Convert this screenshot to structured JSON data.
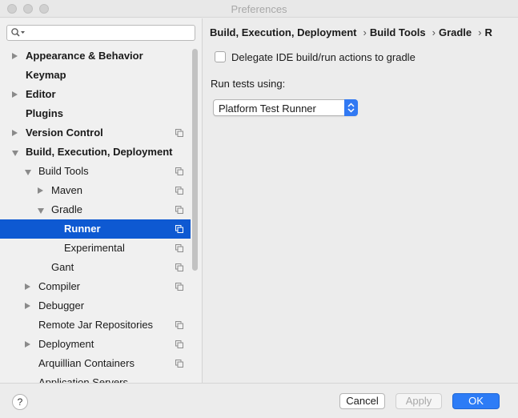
{
  "window": {
    "title": "Preferences"
  },
  "search": {
    "placeholder": ""
  },
  "tree": [
    {
      "label": "Appearance & Behavior",
      "depth": 0,
      "arrow": "right",
      "bold": true,
      "copy": false,
      "selected": false
    },
    {
      "label": "Keymap",
      "depth": 0,
      "arrow": "none",
      "bold": true,
      "copy": false,
      "selected": false
    },
    {
      "label": "Editor",
      "depth": 0,
      "arrow": "right",
      "bold": true,
      "copy": false,
      "selected": false
    },
    {
      "label": "Plugins",
      "depth": 0,
      "arrow": "none",
      "bold": true,
      "copy": false,
      "selected": false
    },
    {
      "label": "Version Control",
      "depth": 0,
      "arrow": "right",
      "bold": true,
      "copy": true,
      "selected": false
    },
    {
      "label": "Build, Execution, Deployment",
      "depth": 0,
      "arrow": "down",
      "bold": true,
      "copy": false,
      "selected": false
    },
    {
      "label": "Build Tools",
      "depth": 1,
      "arrow": "down",
      "bold": false,
      "copy": true,
      "selected": false
    },
    {
      "label": "Maven",
      "depth": 2,
      "arrow": "right",
      "bold": false,
      "copy": true,
      "selected": false
    },
    {
      "label": "Gradle",
      "depth": 2,
      "arrow": "down",
      "bold": false,
      "copy": true,
      "selected": false
    },
    {
      "label": "Runner",
      "depth": 3,
      "arrow": "none",
      "bold": true,
      "copy": true,
      "selected": true
    },
    {
      "label": "Experimental",
      "depth": 3,
      "arrow": "none",
      "bold": false,
      "copy": true,
      "selected": false
    },
    {
      "label": "Gant",
      "depth": 2,
      "arrow": "none",
      "bold": false,
      "copy": true,
      "selected": false
    },
    {
      "label": "Compiler",
      "depth": 1,
      "arrow": "right",
      "bold": false,
      "copy": true,
      "selected": false
    },
    {
      "label": "Debugger",
      "depth": 1,
      "arrow": "right",
      "bold": false,
      "copy": false,
      "selected": false
    },
    {
      "label": "Remote Jar Repositories",
      "depth": 1,
      "arrow": "none",
      "bold": false,
      "copy": true,
      "selected": false
    },
    {
      "label": "Deployment",
      "depth": 1,
      "arrow": "right",
      "bold": false,
      "copy": true,
      "selected": false
    },
    {
      "label": "Arquillian Containers",
      "depth": 1,
      "arrow": "none",
      "bold": false,
      "copy": true,
      "selected": false
    },
    {
      "label": "Application Servers",
      "depth": 1,
      "arrow": "none",
      "bold": false,
      "copy": false,
      "selected": false
    }
  ],
  "breadcrumb": [
    "Build, Execution, Deployment",
    "Build Tools",
    "Gradle",
    "R"
  ],
  "settings": {
    "delegate_label": "Delegate IDE build/run actions to gradle",
    "delegate_checked": false,
    "run_tests_label": "Run tests using:",
    "run_tests_value": "Platform Test Runner"
  },
  "footer": {
    "help_label": "?",
    "cancel_label": "Cancel",
    "apply_label": "Apply",
    "ok_label": "OK"
  },
  "colors": {
    "selection": "#0e59d2",
    "ok_button": "#2d7cf6",
    "stepper": "#3179f3"
  },
  "icons": {
    "search": "search-dropdown-icon",
    "tree_copy": "project-settings-icon",
    "expand": "triangle-right-icon",
    "collapse": "triangle-down-icon"
  }
}
